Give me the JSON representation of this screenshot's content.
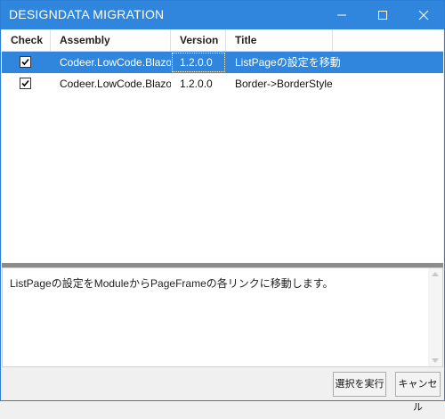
{
  "window": {
    "title": "DESIGNDATA MIGRATION"
  },
  "controls": {
    "minimize_icon": "minimize-icon",
    "maximize_icon": "maximize-icon",
    "close_icon": "close-icon"
  },
  "grid": {
    "columns": [
      "Check",
      "Assembly",
      "Version",
      "Title"
    ],
    "rows": [
      {
        "checked": true,
        "assembly": "Codeer.LowCode.Blazor",
        "version": "1.2.0.0",
        "title": "ListPageの設定を移動",
        "selected": true
      },
      {
        "checked": true,
        "assembly": "Codeer.LowCode.Blazor",
        "version": "1.2.0.0",
        "title": "Border->BorderStyle",
        "selected": false
      }
    ]
  },
  "description": {
    "text": "ListPageの設定をModuleからPageFrameの各リンクに移動します。"
  },
  "buttons": {
    "execute": "選択を実行",
    "cancel": "キャンセル"
  },
  "colors": {
    "accent": "#2f86dc"
  }
}
